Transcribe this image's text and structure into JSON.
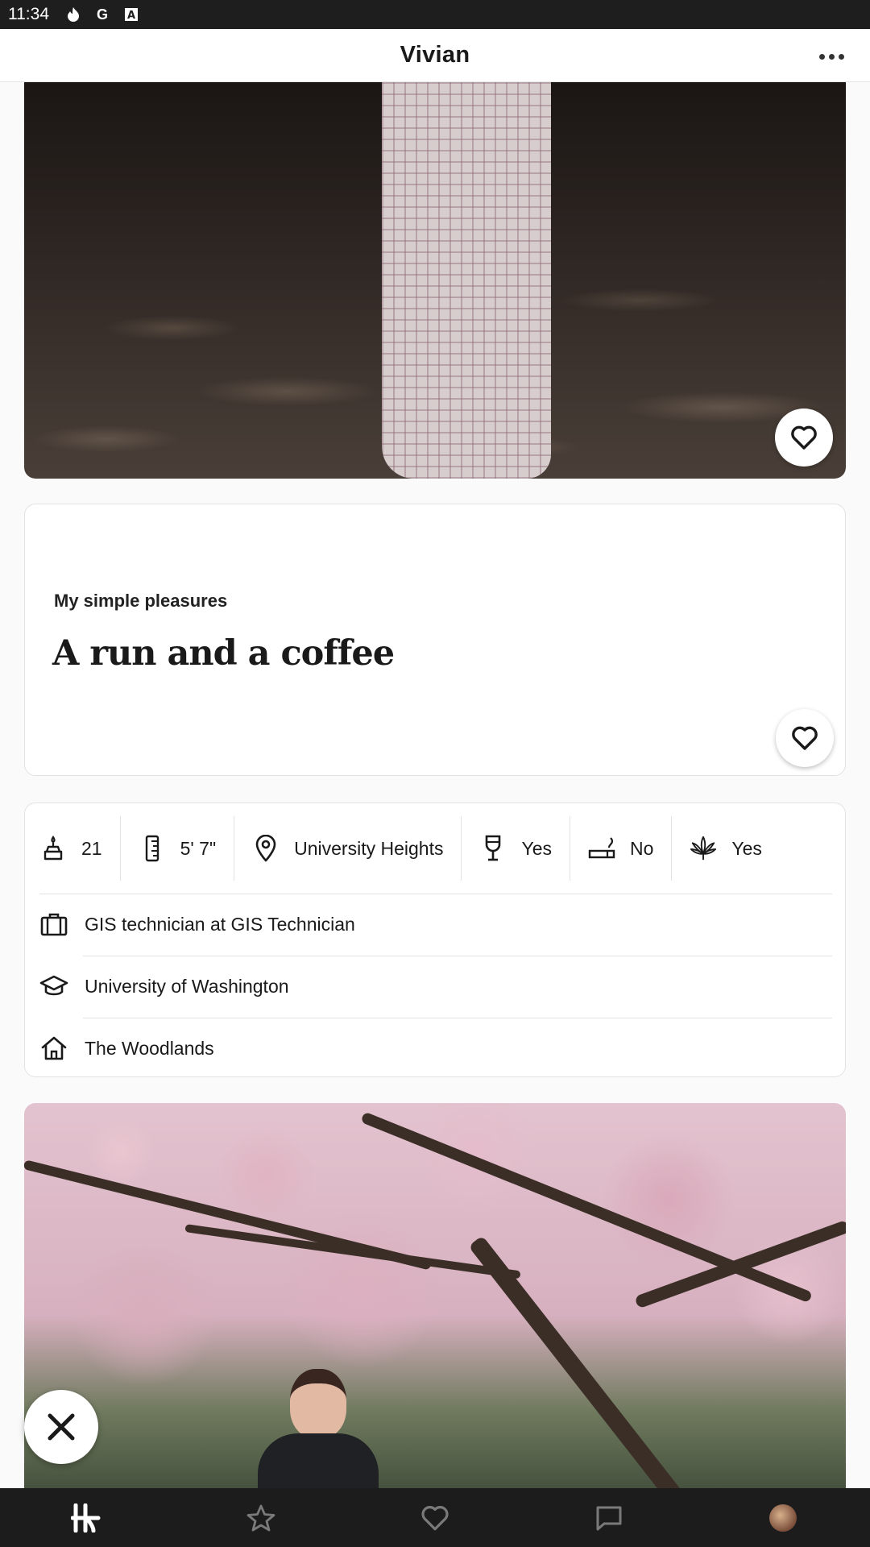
{
  "status_bar": {
    "time": "11:34",
    "icons": [
      "flame-icon",
      "google-icon",
      "font-icon"
    ]
  },
  "header": {
    "name": "Vivian",
    "more_icon": "more-icon"
  },
  "prompt": {
    "question": "My simple pleasures",
    "answer": "A run and a coffee"
  },
  "vitals": [
    {
      "icon": "age-icon",
      "value": "21"
    },
    {
      "icon": "height-icon",
      "value": "5' 7\""
    },
    {
      "icon": "location-pin-icon",
      "value": "University Heights"
    },
    {
      "icon": "drink-icon",
      "value": "Yes"
    },
    {
      "icon": "smoking-icon",
      "value": "No"
    },
    {
      "icon": "cannabis-icon",
      "value": "Yes"
    }
  ],
  "details": {
    "job": "GIS technician at GIS Technician",
    "school": "University of Washington",
    "hometown": "The Woodlands"
  },
  "nav": {
    "items": [
      "home-logo",
      "standouts-star",
      "likes-heart",
      "chat-bubble",
      "profile-avatar"
    ]
  },
  "colors": {
    "nav_bg": "#1c1c1c",
    "card_border": "#e2e2e2"
  }
}
